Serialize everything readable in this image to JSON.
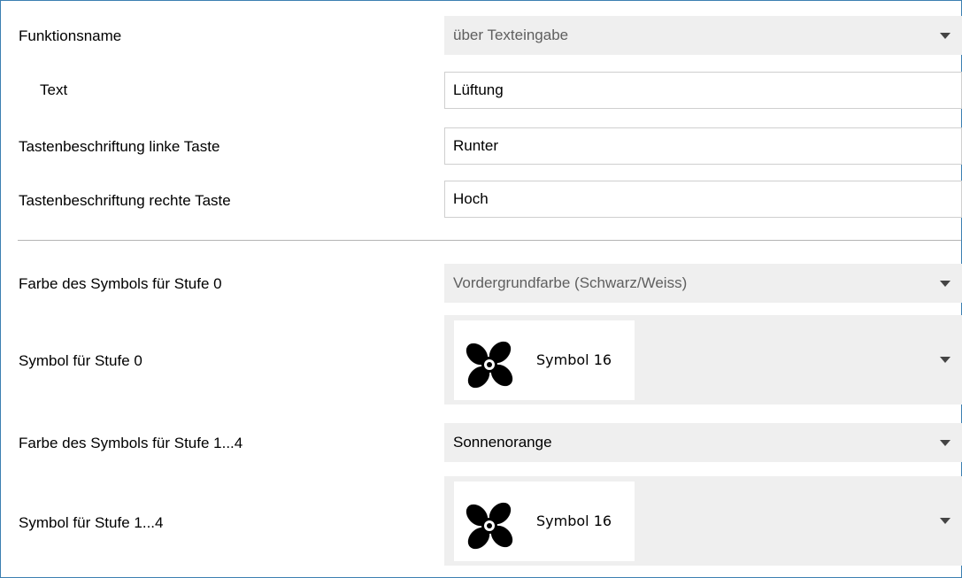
{
  "rows": {
    "funktionsname": {
      "label": "Funktionsname",
      "value": "über Texteingabe"
    },
    "text": {
      "label": "Text",
      "value": "Lüftung"
    },
    "linke_taste": {
      "label": "Tastenbeschriftung linke Taste",
      "value": "Runter"
    },
    "rechte_taste": {
      "label": "Tastenbeschriftung rechte Taste",
      "value": "Hoch"
    },
    "farbe_stufe0": {
      "label": "Farbe des Symbols für Stufe 0",
      "value": "Vordergrundfarbe (Schwarz/Weiss)"
    },
    "symbol_stufe0": {
      "label": "Symbol für Stufe 0",
      "value": "Symbol 16",
      "icon": "fan-icon"
    },
    "farbe_stufe14": {
      "label": "Farbe des Symbols für Stufe 1...4",
      "value": "Sonnenorange"
    },
    "symbol_stufe14": {
      "label": "Symbol für Stufe 1...4",
      "value": "Symbol 16",
      "icon": "fan-icon"
    }
  },
  "colors": {
    "frame_border": "#3c7fb1",
    "dropdown_bg": "#efefef",
    "disabled_text": "#5f5f5f"
  }
}
